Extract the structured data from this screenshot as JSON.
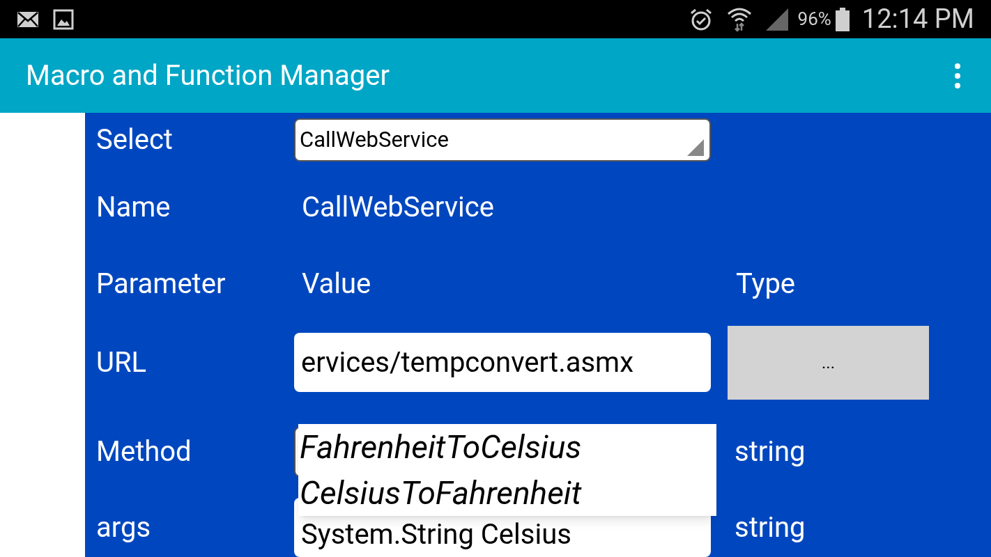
{
  "status_bar": {
    "battery": "96%",
    "time": "12:14 PM"
  },
  "app_bar": {
    "title": "Macro and Function Manager"
  },
  "form": {
    "select": {
      "label": "Select",
      "value": "CallWebService"
    },
    "name": {
      "label": "Name",
      "value": "CallWebService"
    },
    "header": {
      "parameter": "Parameter",
      "value": "Value",
      "type": "Type"
    },
    "rows": [
      {
        "kind": "button",
        "label": "URL",
        "value": "ervices/tempconvert.asmx",
        "type": "..."
      },
      {
        "kind": "spinner",
        "label": "Method",
        "type": "string"
      },
      {
        "kind": "text",
        "label": "args",
        "value": "System.String Celsius",
        "type": "string"
      }
    ]
  },
  "popup": {
    "items": [
      {
        "label": "FahrenheitToCelsius"
      },
      {
        "label": "CelsiusToFahrenheit"
      }
    ]
  }
}
